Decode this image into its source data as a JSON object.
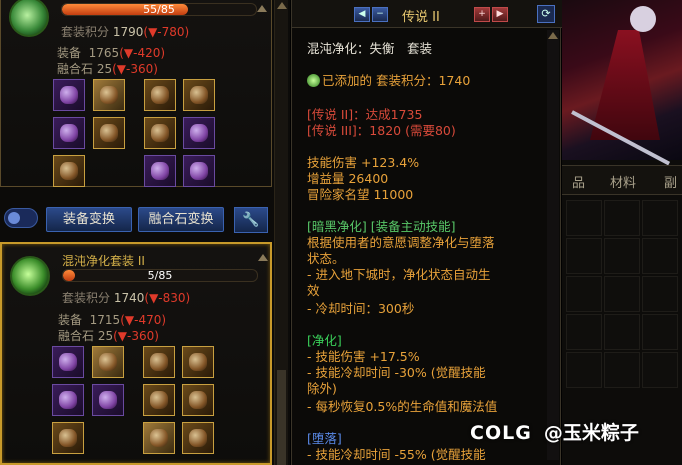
{
  "left": {
    "set1": {
      "progress_text": "55/85",
      "progress": 0.647,
      "score_label": "套装积分",
      "score_value": "1790",
      "score_delta": "(▼-780)",
      "equip_label": "装备",
      "equip_value": "1765",
      "equip_delta": "(▼-420)",
      "fusion_label": "融合石",
      "fusion_value": "25",
      "fusion_delta": "(▼-360)"
    },
    "buttons": {
      "equip_swap": "装备变换",
      "fusion_swap": "融合石变换"
    },
    "set2": {
      "name": "混沌净化套装 II",
      "progress_text": "5/85",
      "progress": 0.06,
      "score_label": "套装积分",
      "score_value": "1740",
      "score_delta": "(▼-830)",
      "equip_label": "装备",
      "equip_value": "1715",
      "equip_delta": "(▼-470)",
      "fusion_label": "融合石",
      "fusion_value": "25",
      "fusion_delta": "(▼-360)"
    }
  },
  "tooltip": {
    "title": "传说 II",
    "set_name": "混沌净化：失衡　套装",
    "added_text": "已添加的 套装积分：1740",
    "leg2": "[传说 II]：达成1735",
    "leg3": "[传说 III]：1820 (需要80)",
    "stat1": "技能伤害 +123.4%",
    "stat2": "增益量 26400",
    "stat3": "冒险家名望 11000",
    "skill_header": "[暗黑净化] [装备主动技能]",
    "skill_desc1": "根据使用者的意愿调整净化与堕落",
    "skill_desc2": "状态。",
    "skill_b1": "- 进入地下城时，净化状态自动生",
    "skill_b1b": "效",
    "skill_b2": "- 冷却时间：300秒",
    "pur_header": "[净化]",
    "pur1": "- 技能伤害 +17.5%",
    "pur2": "- 技能冷却时间 -30% (觉醒技能",
    "pur2b": "除外)",
    "pur3": "- 每秒恢复0.5%的生命值和魔法值",
    "fall_header": "[堕落]",
    "fall1": "- 技能冷却时间 -55% (觉醒技能"
  },
  "right": {
    "tab1": "品",
    "tab2": "材料",
    "tab3": "副"
  },
  "watermark": {
    "logo": "COLG",
    "text": "@玉米粽子"
  },
  "colors": {
    "gold": "#c89a2a",
    "orange": "#e8a23a",
    "red": "#d84a3a",
    "green": "#3ad05a",
    "blue": "#5a8ae8"
  }
}
